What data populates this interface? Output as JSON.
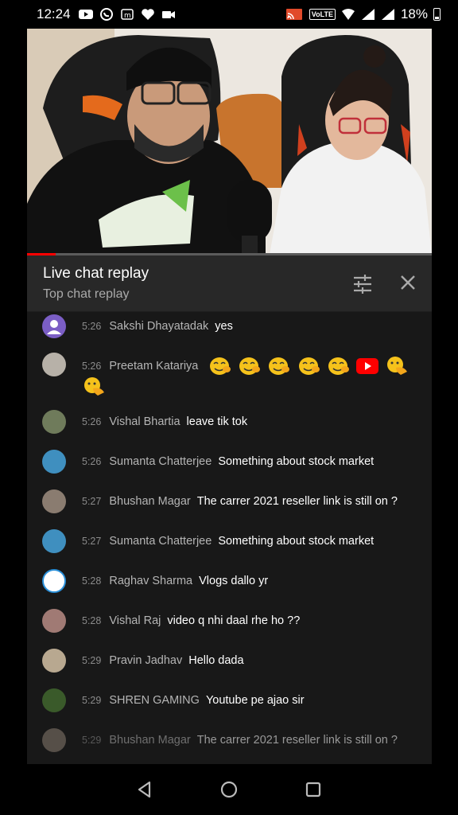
{
  "status_bar": {
    "time": "12:24",
    "volte": "VoLTE",
    "battery": "18%"
  },
  "chat": {
    "title": "Live chat replay",
    "subtitle": "Top chat replay",
    "messages": [
      {
        "time": "5:26",
        "author": "Sakshi Dhayatadak",
        "text": "yes"
      },
      {
        "time": "5:26",
        "author": "Preetam Katariya",
        "text": ""
      },
      {
        "time": "5:26",
        "author": "Vishal Bhartia",
        "text": "leave tik tok"
      },
      {
        "time": "5:26",
        "author": "Sumanta Chatterjee",
        "text": "Something about stock market"
      },
      {
        "time": "5:27",
        "author": "Bhushan Magar",
        "text": "The carrer 2021 reseller link is still on ?"
      },
      {
        "time": "5:27",
        "author": "Sumanta Chatterjee",
        "text": "Something about stock market"
      },
      {
        "time": "5:28",
        "author": "Raghav Sharma",
        "text": "Vlogs dallo yr"
      },
      {
        "time": "5:28",
        "author": "Vishal Raj",
        "text": "video q nhi daal rhe ho ??"
      },
      {
        "time": "5:29",
        "author": "Pravin Jadhav",
        "text": "Hello dada"
      },
      {
        "time": "5:29",
        "author": "SHREN GAMING",
        "text": "Youtube pe ajao sir"
      },
      {
        "time": "5:29",
        "author": "Bhushan Magar",
        "text": "The carrer 2021 reseller link is still on ?"
      }
    ]
  },
  "video": {
    "progress": 0.07
  },
  "colors": {
    "accent": "#ff0000",
    "panel": "#181818",
    "header": "#282828"
  }
}
